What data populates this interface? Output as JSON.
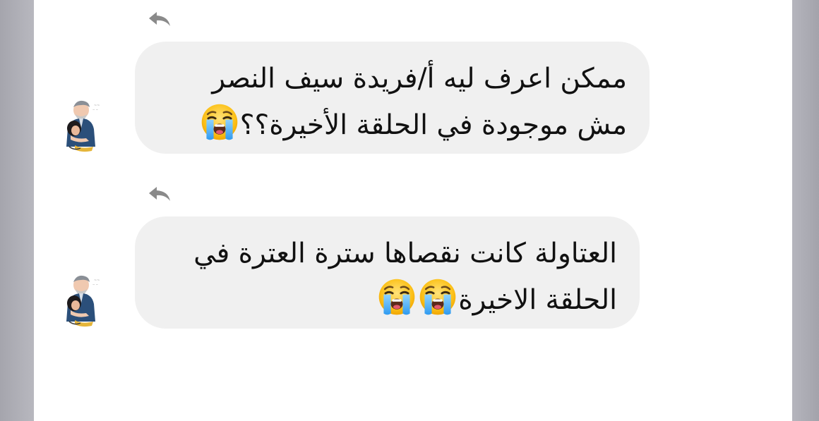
{
  "conversation": {
    "messages": [
      {
        "line1": "ممكن اعرف ليه أ/فريدة سيف النصر",
        "line2": "مش موجودة في الحلقة الأخيرة؟؟",
        "reaction_emoji": "loudly-crying-face",
        "reaction_count": 1
      },
      {
        "line1": "العتاولة كانت نقصاها سترة العترة في",
        "line2": "الحلقة الاخيرة",
        "reaction_emoji": "loudly-crying-face",
        "reaction_count": 2
      }
    ]
  },
  "icons": {
    "reply": "reply-arrow-icon",
    "emoji": "loudly-crying-face-emoji"
  },
  "colors": {
    "bubble_background": "#f0f0f0",
    "panel_background": "#ffffff",
    "side_background": "#ababb3",
    "reply_icon": "#8a8a8a",
    "text": "#111111"
  }
}
